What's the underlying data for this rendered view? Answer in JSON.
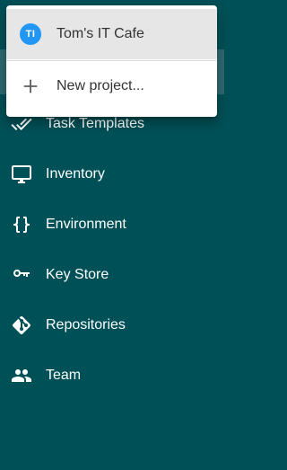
{
  "project_menu": {
    "current_project": {
      "avatar_initials": "TI",
      "name": "Tom's IT Cafe"
    },
    "new_project_label": "New project..."
  },
  "nav": {
    "items": [
      {
        "label": "Task Templates",
        "icon": "double-check-icon"
      },
      {
        "label": "Inventory",
        "icon": "monitor-icon"
      },
      {
        "label": "Environment",
        "icon": "curly-braces-icon"
      },
      {
        "label": "Key Store",
        "icon": "key-icon"
      },
      {
        "label": "Repositories",
        "icon": "git-icon"
      },
      {
        "label": "Team",
        "icon": "team-icon"
      }
    ]
  },
  "colors": {
    "sidebar_bg": "#005057",
    "avatar_bg": "#2196f3",
    "menu_selected_bg": "#e6e6e6"
  }
}
